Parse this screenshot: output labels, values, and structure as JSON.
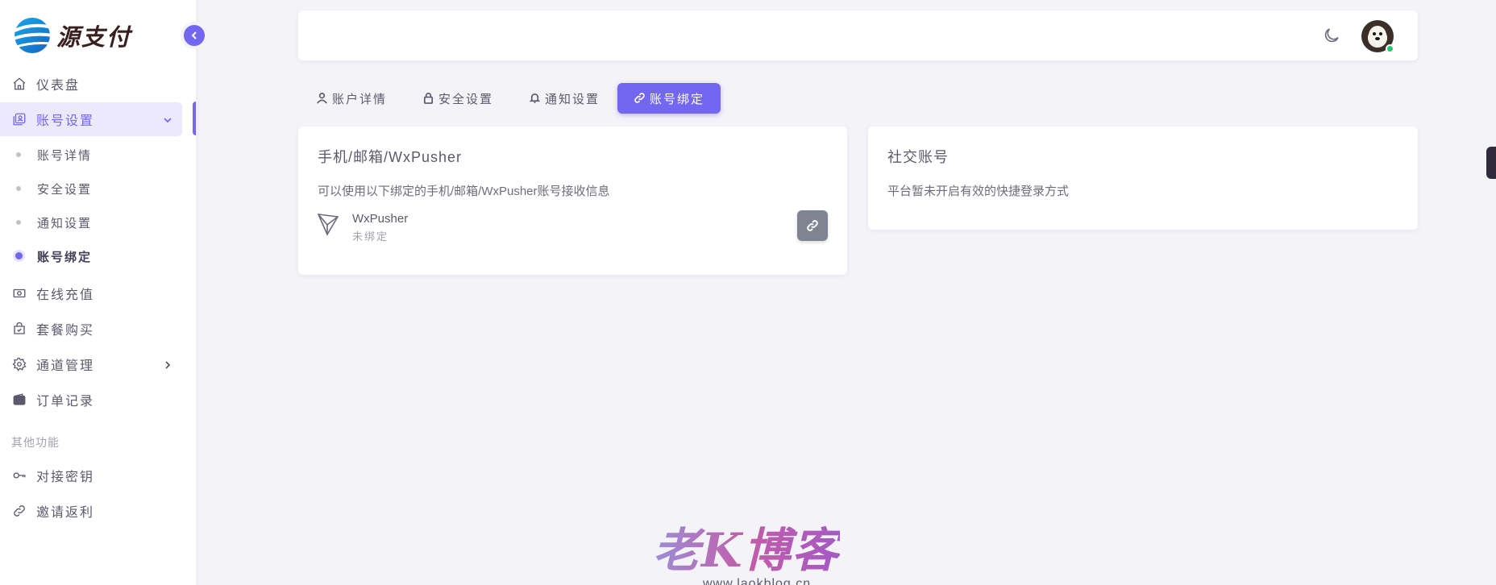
{
  "brand": {
    "name": "源支付"
  },
  "sidebar": {
    "items": [
      {
        "label": "仪表盘",
        "icon": "home-icon"
      },
      {
        "label": "账号设置",
        "icon": "user-card-icon",
        "open": true
      },
      {
        "label": "在线充值",
        "icon": "cash-icon"
      },
      {
        "label": "套餐购买",
        "icon": "shopping-bag-icon"
      },
      {
        "label": "通道管理",
        "icon": "gear-icon"
      },
      {
        "label": "订单记录",
        "icon": "wallet-icon"
      }
    ],
    "submenu": [
      {
        "label": "账号详情"
      },
      {
        "label": "安全设置"
      },
      {
        "label": "通知设置"
      },
      {
        "label": "账号绑定",
        "active": true
      }
    ],
    "section_label": "其他功能",
    "other_items": [
      {
        "label": "对接密钥",
        "icon": "key-icon"
      },
      {
        "label": "邀请返利",
        "icon": "link-icon"
      }
    ]
  },
  "tabs": [
    {
      "label": "账户详情",
      "icon": "user-icon"
    },
    {
      "label": "安全设置",
      "icon": "lock-icon"
    },
    {
      "label": "通知设置",
      "icon": "bell-icon"
    },
    {
      "label": "账号绑定",
      "icon": "link-icon",
      "active": true
    }
  ],
  "binding_card": {
    "title": "手机/邮箱/WxPusher",
    "description": "可以使用以下绑定的手机/邮箱/WxPusher账号接收信息",
    "item_name": "WxPusher",
    "item_status": "未绑定"
  },
  "social_card": {
    "title": "社交账号",
    "description": "平台暂未开启有效的快捷登录方式"
  },
  "watermark": {
    "text": "老K博客",
    "sub": "www.laokblog.cn"
  },
  "colors": {
    "accent": "#7367f0",
    "online": "#28c76f"
  }
}
